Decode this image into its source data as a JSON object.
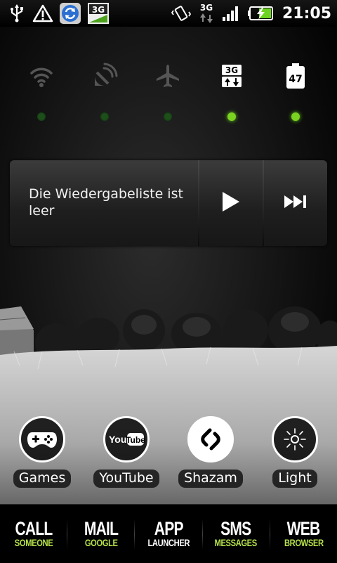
{
  "status_bar": {
    "left_icons": [
      "usb-icon",
      "warning-icon",
      "sync-icon",
      "3g-app-icon"
    ],
    "right_icons": [
      "vibrate-icon",
      "3g-data-icon",
      "signal-icon",
      "battery-charging-icon"
    ],
    "time": "21:05"
  },
  "toggles": {
    "items": [
      {
        "name": "wifi",
        "icon": "wifi-icon",
        "state": "off"
      },
      {
        "name": "satellite",
        "icon": "satellite-icon",
        "state": "off"
      },
      {
        "name": "airplane",
        "icon": "airplane-icon",
        "state": "off"
      },
      {
        "name": "3g",
        "icon": "3g-toggle-icon",
        "label": "3G",
        "state": "on"
      },
      {
        "name": "battery",
        "icon": "battery-icon",
        "label": "47",
        "state": "on"
      }
    ],
    "colors": {
      "on": "#7bd321",
      "off": "#1e4f1a"
    }
  },
  "music": {
    "text": "Die Wiedergabeliste ist leer",
    "play_icon": "play-icon",
    "next_icon": "skip-next-icon"
  },
  "apps": [
    {
      "label": "Games",
      "icon": "gamepad-icon"
    },
    {
      "label": "YouTube",
      "icon": "youtube-icon",
      "logo_text": "YouTube"
    },
    {
      "label": "Shazam",
      "icon": "shazam-icon"
    },
    {
      "label": "Light",
      "icon": "light-icon"
    }
  ],
  "dock": [
    {
      "main": "CALL",
      "sub": "SOMEONE",
      "sub_color": "#b6e24a"
    },
    {
      "main": "MAIL",
      "sub": "GOOGLE",
      "sub_color": "#b6e24a"
    },
    {
      "main": "APP",
      "sub": "LAUNCHER",
      "sub_color": "#ffffff"
    },
    {
      "main": "SMS",
      "sub": "MESSAGES",
      "sub_color": "#b6e24a"
    },
    {
      "main": "WEB",
      "sub": "BROWSER",
      "sub_color": "#b6e24a"
    }
  ]
}
